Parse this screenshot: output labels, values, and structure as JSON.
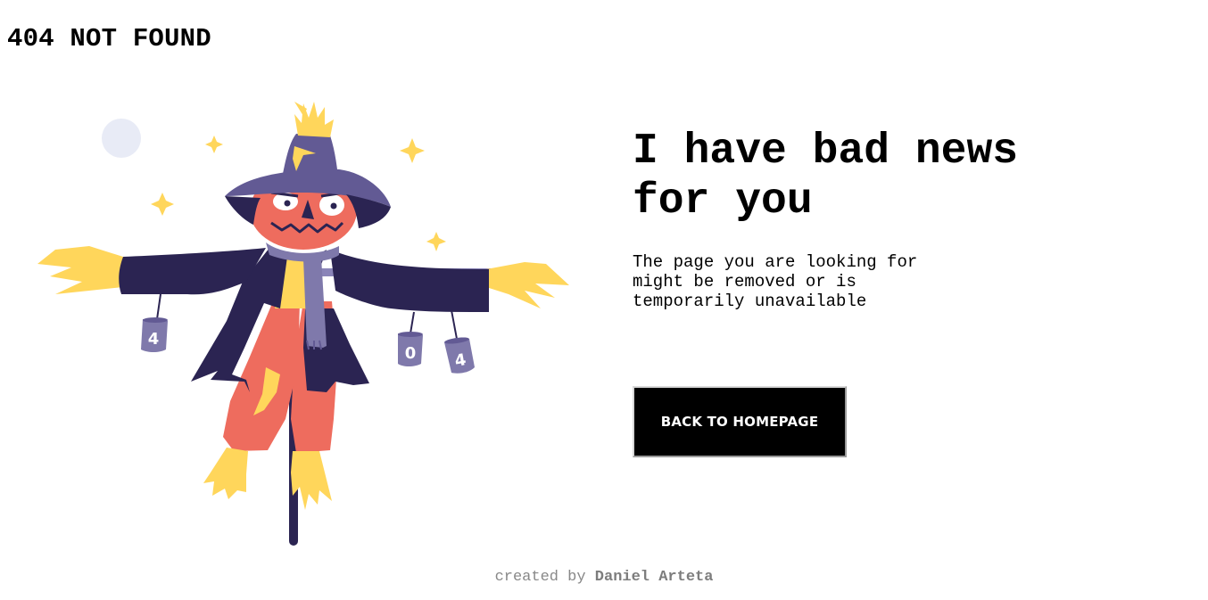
{
  "header": {
    "title": "404 NOT FOUND"
  },
  "main": {
    "headline": "I have bad news for you",
    "message": "The page you are looking for might be removed or is temporarily unavailable",
    "button_label": "BACK TO HOMEPAGE"
  },
  "illustration": {
    "subject": "scarecrow-icon",
    "cans": [
      "4",
      "0",
      "4"
    ],
    "colors": {
      "coat": "#2b2452",
      "hat": "#625a94",
      "face": "#ee6c5e",
      "straw": "#ffd65b",
      "scarf": "#7f79ab",
      "moon": "#e8ebf6"
    }
  },
  "footer": {
    "prefix": "created by",
    "author": "Daniel Arteta"
  }
}
